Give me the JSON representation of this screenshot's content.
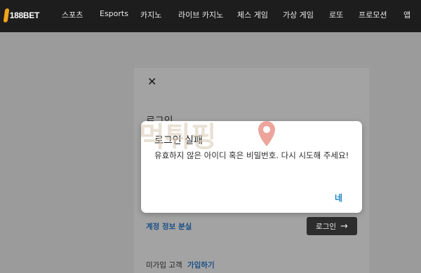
{
  "brand": {
    "logo_text": "188BET",
    "accent": "#f0a51e"
  },
  "nav": {
    "items": [
      {
        "label": "스포츠"
      },
      {
        "label": "Esports"
      },
      {
        "label": "카지노"
      },
      {
        "label": "라이브 카지노"
      },
      {
        "label": "체스 게임"
      },
      {
        "label": "가상 게임"
      },
      {
        "label": "로또"
      },
      {
        "label": "프로모션"
      },
      {
        "label": "앱"
      }
    ]
  },
  "login_panel": {
    "close_icon": "close-icon",
    "heading": "로그인",
    "forgot_link": "계정 정보 분실",
    "login_button": "로그인",
    "signup_prompt": "미가입 고객",
    "signup_link": "가입하기"
  },
  "dialog": {
    "title": "로그인 실패",
    "message": "유효하지 않은 아이디 혹은 비밀번호. 다시 시도해 주세요!",
    "ok_label": "네"
  },
  "watermark": {
    "text": "먹튀핑",
    "pin_color": "#e05a4a"
  }
}
